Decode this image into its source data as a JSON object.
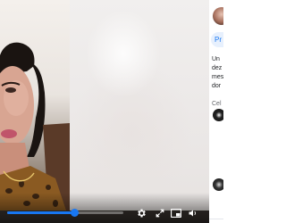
{
  "player": {
    "progress_fraction": 0.58,
    "accent_color": "#1877f2",
    "controls": {
      "settings_icon": "gear-icon",
      "fullscreen_icon": "expand-icon",
      "pip_icon": "picture-in-picture-icon",
      "volume_icon": "volume-icon"
    }
  },
  "rail": {
    "chip_label": "Pr",
    "post_lines": [
      "Un",
      "dez",
      "mes",
      "dor"
    ],
    "caption": "Cel"
  }
}
